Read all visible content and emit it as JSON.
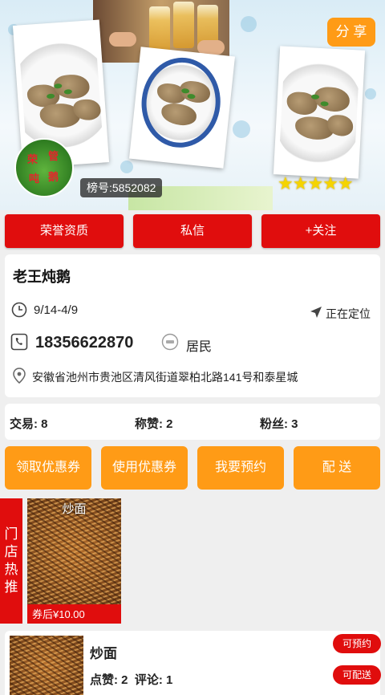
{
  "header": {
    "share_label": "分 享",
    "rank_label": "榜号:5852082",
    "stars": "★★★★★",
    "avatar_text": [
      "荣",
      "管",
      "吨",
      "鹅"
    ]
  },
  "actions": {
    "honor": "荣誉资质",
    "message": "私信",
    "follow": "+关注"
  },
  "store": {
    "name": "老王炖鹅",
    "hours": "9/14-4/9",
    "locating": "正在定位",
    "phone": "18356622870",
    "type": "居民",
    "address": "安徽省池州市贵池区清风街道翠柏北路141号和泰星城"
  },
  "stats": {
    "trades": "交易: 8",
    "likes": "称赞: 2",
    "fans": "粉丝: 3"
  },
  "quick_buttons": {
    "get_coupon": "领取优惠券",
    "use_coupon": "使用优惠券",
    "reserve": "我要预约",
    "delivery": "配 送"
  },
  "hot": {
    "tab_chars": [
      "门",
      "店",
      "热",
      "推"
    ],
    "item_name": "炒面",
    "item_price": "券后¥10.00"
  },
  "product": {
    "name": "炒面",
    "likes_comments": "点赞: 2  评论: 1",
    "reserve_label": "可预约",
    "delivery_label": "可配送"
  },
  "colors": {
    "accent_red": "#e00d0d",
    "accent_orange": "#ff9b16",
    "star": "#f5d400"
  }
}
